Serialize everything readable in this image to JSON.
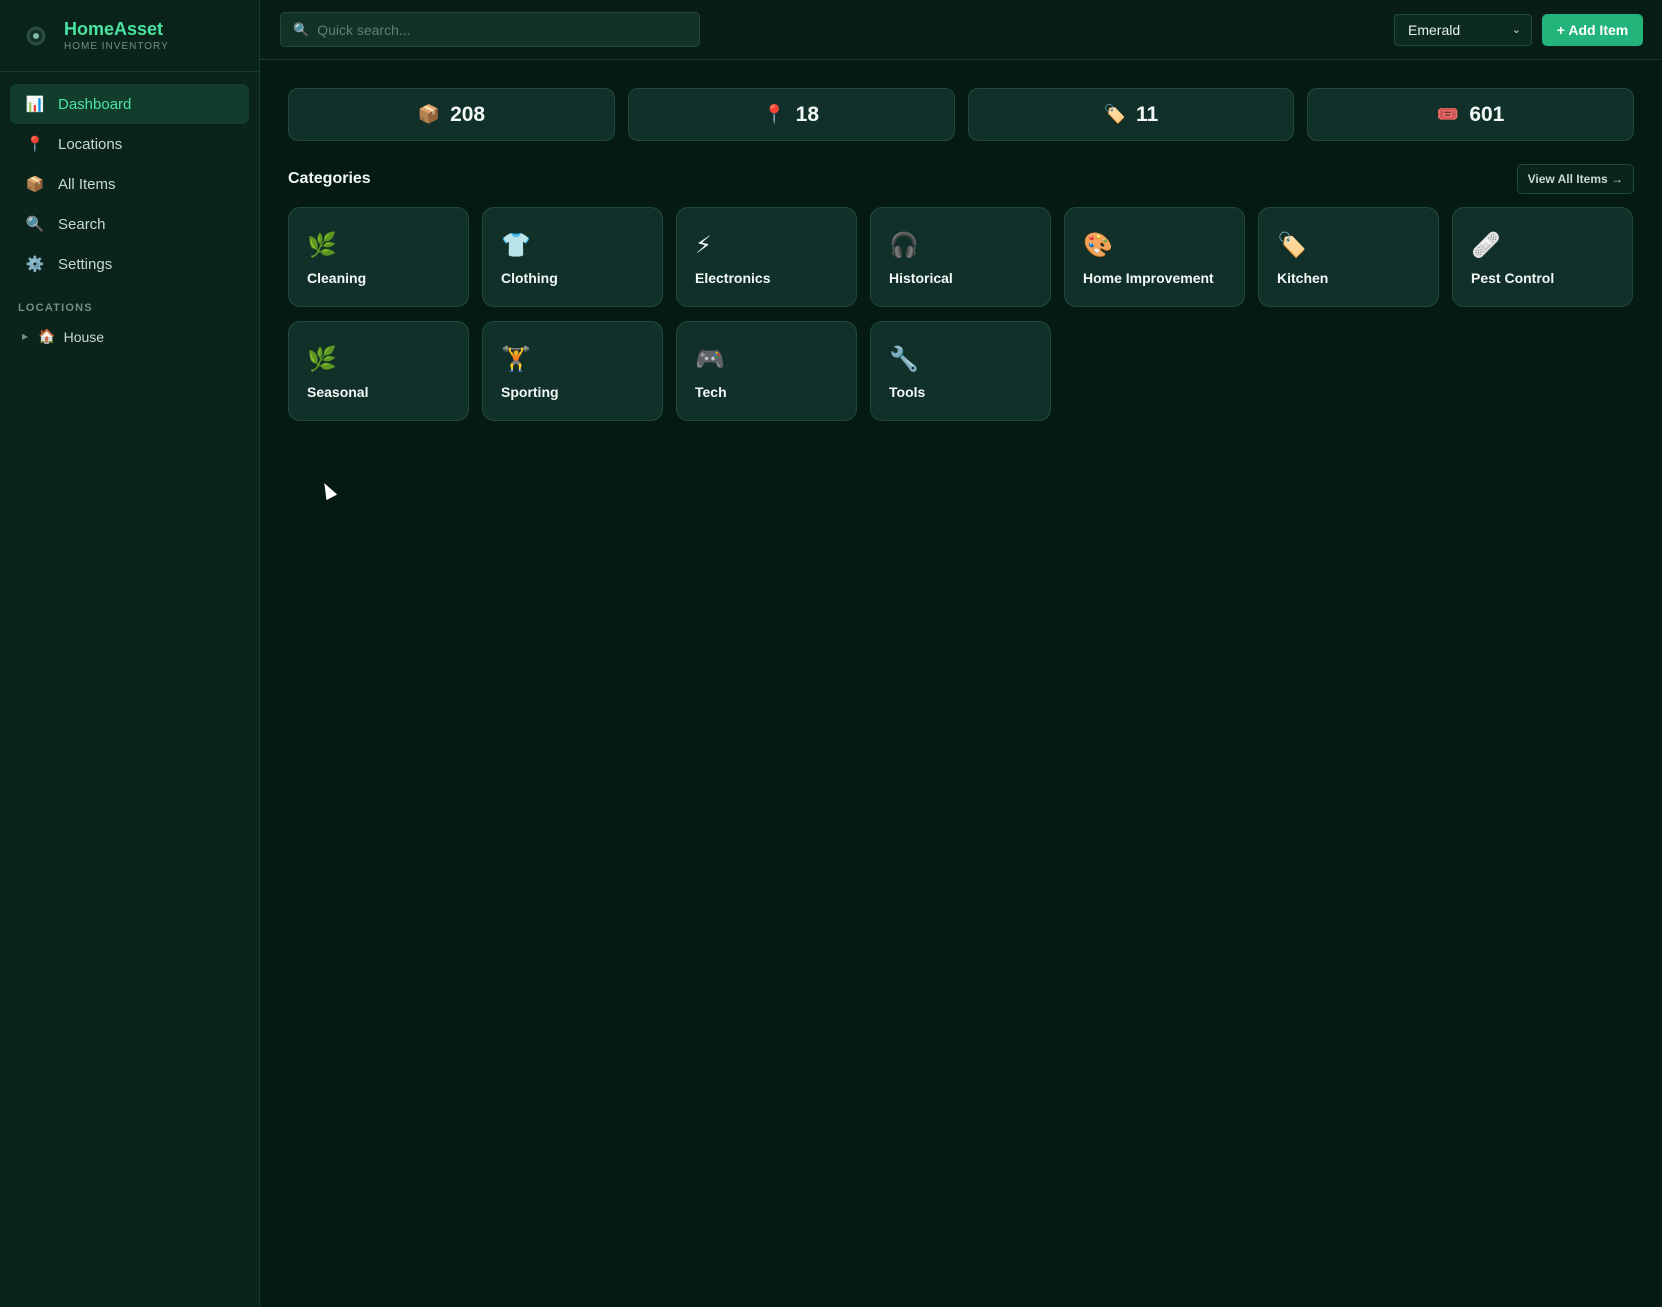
{
  "brand": {
    "title": "HomeAsset",
    "subtitle": "HOME INVENTORY"
  },
  "sidebar": {
    "items": [
      {
        "label": "Dashboard",
        "icon": "📊",
        "active": true
      },
      {
        "label": "Locations",
        "icon": "📍"
      },
      {
        "label": "All Items",
        "icon": "📦"
      },
      {
        "label": "Search",
        "icon": "🔍"
      },
      {
        "label": "Settings",
        "icon": "⚙️"
      }
    ],
    "section_title": "LOCATIONS",
    "locations": [
      {
        "label": "House",
        "icon": "🏠"
      }
    ]
  },
  "topbar": {
    "search_placeholder": "Quick search...",
    "theme": "Emerald",
    "add_label": "+ Add Item"
  },
  "stats": [
    {
      "icon": "📦",
      "value": "208"
    },
    {
      "icon": "📍",
      "value": "18"
    },
    {
      "icon": "🏷️",
      "value": "11"
    },
    {
      "icon": "🎟️",
      "value": "601"
    }
  ],
  "categories_section": {
    "title": "Categories",
    "view_all": "View All Items →",
    "items": [
      {
        "label": "Cleaning",
        "icon": "🌿"
      },
      {
        "label": "Clothing",
        "icon": "👕"
      },
      {
        "label": "Electronics",
        "icon": "⚡"
      },
      {
        "label": "Historical",
        "icon": "🎧"
      },
      {
        "label": "Home Improvement",
        "icon": "🎨"
      },
      {
        "label": "Kitchen",
        "icon": "🏷️"
      },
      {
        "label": "Pest Control",
        "icon": "🩹"
      },
      {
        "label": "Seasonal",
        "icon": "🌿"
      },
      {
        "label": "Sporting",
        "icon": "🏋️"
      },
      {
        "label": "Tech",
        "icon": "🎮"
      },
      {
        "label": "Tools",
        "icon": "🔧"
      }
    ]
  }
}
